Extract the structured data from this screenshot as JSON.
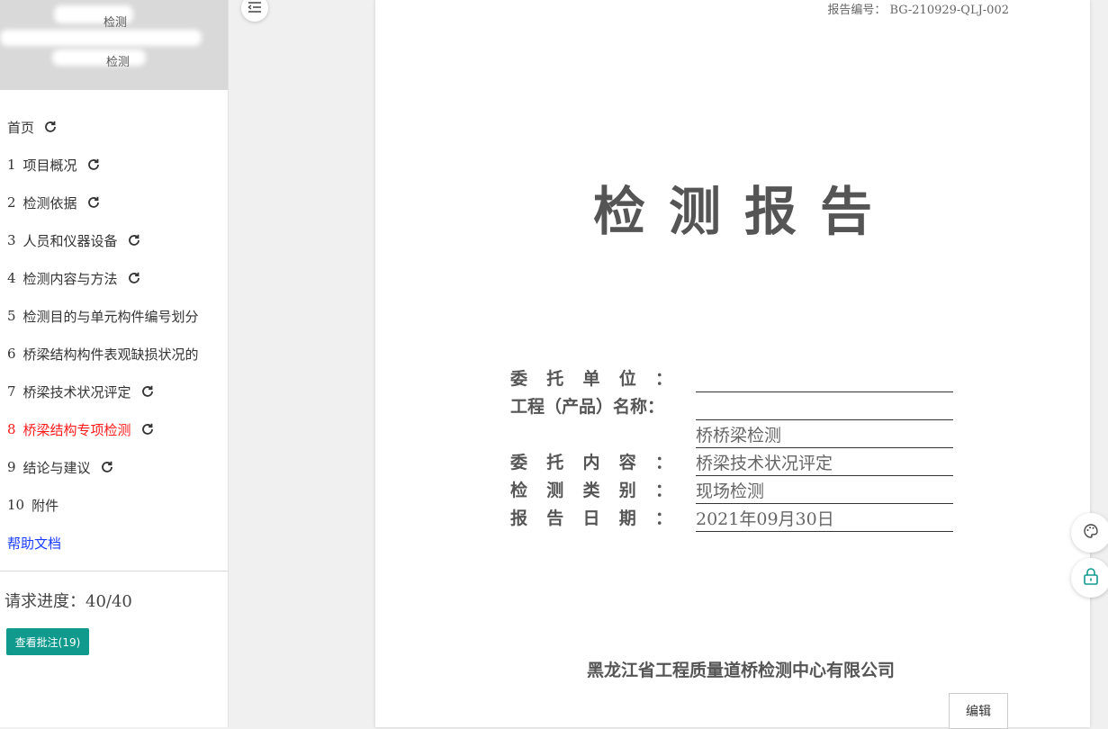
{
  "sidebar": {
    "header": {
      "line1": "检测",
      "line2": "检测"
    },
    "items": [
      {
        "num": "",
        "label": "首页",
        "refresh": true,
        "state": "normal"
      },
      {
        "num": "1",
        "label": "项目概况",
        "refresh": true,
        "state": "normal"
      },
      {
        "num": "2",
        "label": "检测依据",
        "refresh": true,
        "state": "normal"
      },
      {
        "num": "3",
        "label": "人员和仪器设备",
        "refresh": true,
        "state": "normal"
      },
      {
        "num": "4",
        "label": "检测内容与方法",
        "refresh": true,
        "state": "normal"
      },
      {
        "num": "5",
        "label": "检测目的与单元构件编号划分",
        "refresh": false,
        "state": "normal"
      },
      {
        "num": "6",
        "label": "桥梁结构构件表观缺损状况的",
        "refresh": false,
        "state": "normal"
      },
      {
        "num": "7",
        "label": "桥梁技术状况评定",
        "refresh": true,
        "state": "normal"
      },
      {
        "num": "8",
        "label": "桥梁结构专项检测",
        "refresh": true,
        "state": "active"
      },
      {
        "num": "9",
        "label": "结论与建议",
        "refresh": true,
        "state": "normal"
      },
      {
        "num": "10",
        "label": "附件",
        "refresh": false,
        "state": "normal"
      }
    ],
    "help_label": "帮助文档",
    "progress_text": "请求进度：40/40",
    "annotations_button": "查看批注(19)"
  },
  "document": {
    "report_number": "报告编号： BG-210929-QLJ-002",
    "title": "检测报告",
    "fields": {
      "client_label": "委托单位：",
      "client_value": "",
      "project_label": "工程（产品）名称：",
      "project_value": "",
      "project_value2": "桥桥梁检测",
      "content_label": "委托内容：",
      "content_value": "桥梁技术状况评定",
      "category_label": "检测类别：",
      "category_value": "现场检测",
      "date_label": "报告日期：",
      "date_value": "2021年09月30日"
    },
    "company": "黑龙江省工程质量道桥检测中心有限公司",
    "edit_button": "编辑"
  },
  "colors": {
    "accent": "#0f9a8d",
    "active_nav": "#ff1a1a",
    "help_link": "#1a3cff"
  },
  "icons": [
    "menu-collapse-icon",
    "refresh-icon",
    "palette-icon",
    "lock-icon"
  ]
}
